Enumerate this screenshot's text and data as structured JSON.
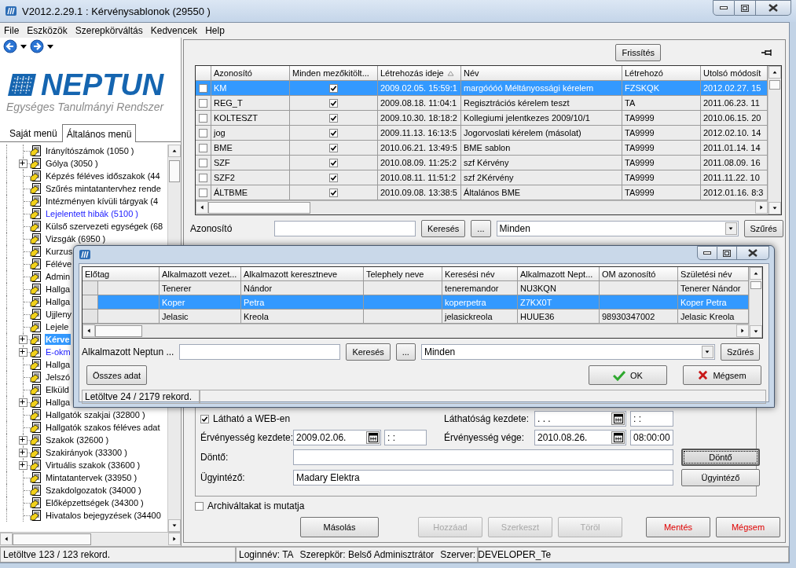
{
  "window": {
    "title": "V2012.2.29.1 : Kérvénysablonok (29550  )"
  },
  "menu": [
    "File",
    "Eszközök",
    "Szerepkörváltás",
    "Kedvencek",
    "Help"
  ],
  "sidebar": {
    "logo": {
      "name": "NEPTUN",
      "tagline": "Egységes Tanulmányi Rendszer"
    },
    "tabs": [
      {
        "label": "Saját menü",
        "selected": false
      },
      {
        "label": "Általános menü",
        "selected": true
      }
    ],
    "tree": [
      {
        "label": "Irányítószámok (1050  )",
        "kind": "normal",
        "expandable": false,
        "selected": false
      },
      {
        "label": "Gólya (3050  )",
        "kind": "normal",
        "expandable": true,
        "selected": false
      },
      {
        "label": "Képzés féléves időszakok (44",
        "kind": "normal",
        "expandable": false,
        "selected": false
      },
      {
        "label": "Szűrés mintatantervhez rende",
        "kind": "normal",
        "expandable": false,
        "selected": false
      },
      {
        "label": "Intézményen kívüli tárgyak (4",
        "kind": "normal",
        "expandable": false,
        "selected": false
      },
      {
        "label": "Lejelentett hibák (5100  )",
        "kind": "link",
        "expandable": false,
        "selected": false
      },
      {
        "label": "Külső szervezeti egységek (68",
        "kind": "normal",
        "expandable": false,
        "selected": false
      },
      {
        "label": "Vizsgák (6950  )",
        "kind": "normal",
        "expandable": false,
        "selected": false
      },
      {
        "label": "Kurzus",
        "kind": "normal",
        "expandable": false,
        "selected": false
      },
      {
        "label": "Féléve",
        "kind": "normal",
        "expandable": false,
        "selected": false
      },
      {
        "label": "Admin",
        "kind": "normal",
        "expandable": false,
        "selected": false
      },
      {
        "label": "Hallga",
        "kind": "normal",
        "expandable": false,
        "selected": false
      },
      {
        "label": "Hallga",
        "kind": "normal",
        "expandable": false,
        "selected": false
      },
      {
        "label": "Ujjleny",
        "kind": "normal",
        "expandable": false,
        "selected": false
      },
      {
        "label": "Lejele",
        "kind": "normal",
        "expandable": false,
        "selected": false
      },
      {
        "label": "Kérve",
        "kind": "normal",
        "expandable": true,
        "selected": true
      },
      {
        "label": "E-okm",
        "kind": "link",
        "expandable": true,
        "selected": false
      },
      {
        "label": "Hallga",
        "kind": "normal",
        "expandable": false,
        "selected": false
      },
      {
        "label": "Jelszó",
        "kind": "normal",
        "expandable": false,
        "selected": false
      },
      {
        "label": "Elküld",
        "kind": "normal",
        "expandable": false,
        "selected": false
      },
      {
        "label": "Hallga",
        "kind": "normal",
        "expandable": true,
        "selected": false
      },
      {
        "label": "Hallgatók szakjai (32800  )",
        "kind": "normal",
        "expandable": false,
        "selected": false
      },
      {
        "label": "Hallgatók szakos féléves adat",
        "kind": "normal",
        "expandable": false,
        "selected": false
      },
      {
        "label": "Szakok (32600  )",
        "kind": "normal",
        "expandable": true,
        "selected": false
      },
      {
        "label": "Szakirányok (33300  )",
        "kind": "normal",
        "expandable": true,
        "selected": false
      },
      {
        "label": "Virtuális szakok (33600  )",
        "kind": "normal",
        "expandable": true,
        "selected": false
      },
      {
        "label": "Mintatantervek (33950  )",
        "kind": "normal",
        "expandable": false,
        "selected": false
      },
      {
        "label": "Szakdolgozatok (34000  )",
        "kind": "normal",
        "expandable": false,
        "selected": false
      },
      {
        "label": "Előképzettségek (34300  )",
        "kind": "normal",
        "expandable": false,
        "selected": false
      },
      {
        "label": "Hivatalos bejegyzések (34400",
        "kind": "normal",
        "expandable": false,
        "selected": false
      }
    ]
  },
  "templates": {
    "refresh_button": "Frissítés",
    "columns": [
      {
        "label": "Azonosító",
        "sorted": false
      },
      {
        "label": "Minden mezőkitölt...",
        "sorted": false
      },
      {
        "label": "Létrehozás ideje",
        "sorted": true
      },
      {
        "label": "Név",
        "sorted": false
      },
      {
        "label": "Létrehozó",
        "sorted": false
      },
      {
        "label": "Utolsó módosít",
        "sorted": false
      }
    ],
    "rows": [
      {
        "marked": false,
        "selected": true,
        "cells": [
          "KM",
          {
            "kind": "checkbox",
            "checked": true
          },
          "2009.02.05. 15:59:1",
          "margóóóó Méltányossági kérelem",
          "FZSKQK",
          "2012.02.27. 15"
        ]
      },
      {
        "marked": false,
        "selected": false,
        "cells": [
          "REG_T",
          {
            "kind": "checkbox",
            "checked": true
          },
          "2009.08.18. 11:04:1",
          "Regisztrációs kérelem teszt",
          "TA",
          "2011.06.23. 11"
        ]
      },
      {
        "marked": false,
        "selected": false,
        "cells": [
          "KOLTESZT",
          {
            "kind": "checkbox",
            "checked": true
          },
          "2009.10.30. 18:18:2",
          "Kollegiumi jelentkezes 2009/10/1",
          "TA9999",
          "2010.06.15. 20"
        ]
      },
      {
        "marked": false,
        "selected": false,
        "cells": [
          "jog",
          {
            "kind": "checkbox",
            "checked": true
          },
          "2009.11.13. 16:13:5",
          "Jogorvoslati kérelem (másolat)",
          "TA9999",
          "2012.02.10. 14"
        ]
      },
      {
        "marked": false,
        "selected": false,
        "cells": [
          "BME",
          {
            "kind": "checkbox",
            "checked": true
          },
          "2010.06.21. 13:49:5",
          "BME sablon",
          "TA9999",
          "2011.01.14. 14"
        ]
      },
      {
        "marked": false,
        "selected": false,
        "cells": [
          "SZF",
          {
            "kind": "checkbox",
            "checked": true
          },
          "2010.08.09. 11:25:2",
          "szf Kérvény",
          "TA9999",
          "2011.08.09. 16"
        ]
      },
      {
        "marked": false,
        "selected": false,
        "cells": [
          "SZF2",
          {
            "kind": "checkbox",
            "checked": true
          },
          "2010.08.11. 11:51:2",
          "szf 2Kérvény",
          "TA9999",
          "2011.11.22. 10"
        ]
      },
      {
        "marked": false,
        "selected": false,
        "cells": [
          "ÁLTBME",
          {
            "kind": "checkbox",
            "checked": true
          },
          "2010.09.08. 13:38:5",
          "Általános BME",
          "TA9999",
          "2012.01.16. 8:3"
        ]
      }
    ],
    "filter": {
      "label": "Azonosító",
      "search": "Keresés",
      "more": "...",
      "scope": "Minden",
      "filter_button": "Szűrés"
    }
  },
  "dialog": {
    "columns": [
      "Előtag",
      "Alkalmazott vezet...",
      "Alkalmazott keresztneve",
      "Telephely neve",
      "Keresési név",
      "Alkalmazott Nept...",
      "OM azonosító",
      "Születési név"
    ],
    "rows": [
      {
        "selected": false,
        "cells": [
          null,
          "Tenerer",
          "Nándor",
          null,
          "teneremandor",
          "NU3KQN",
          null,
          "Tenerer Nándor"
        ]
      },
      {
        "selected": true,
        "cells": [
          null,
          "Koper",
          "Petra",
          null,
          "koperpetra",
          "Z7KX0T",
          null,
          "Koper Petra"
        ]
      },
      {
        "selected": false,
        "cells": [
          null,
          "Jelasic",
          "Kreola",
          null,
          "jelasickreola",
          "HUUE36",
          "98930347002",
          "Jelasic Kreola"
        ]
      }
    ],
    "filter": {
      "label": "Alkalmazott Neptun ...",
      "search": "Keresés",
      "more": "...",
      "scope": "Minden",
      "filter_button": "Szűrés"
    },
    "all_button": "Összes adat",
    "ok_button": "OK",
    "cancel_button": "Mégsem",
    "status": "Letöltve 24 / 2179 rekord."
  },
  "form": {
    "web_visible": {
      "label": "Látható a WEB-en",
      "checked": true
    },
    "visibility_start": {
      "label": "Láthatóság kezdete:",
      "date": ". . .",
      "time": ": :"
    },
    "validity_start": {
      "label": "Érvényesség kezdete:",
      "date": "2009.02.06.",
      "time": ": :"
    },
    "validity_end": {
      "label": "Érvényesség vége:",
      "date": "2010.08.26.",
      "time": "08:00:00"
    },
    "decider": {
      "label": "Döntő:",
      "button": "Döntő",
      "focused": true
    },
    "clerk": {
      "label": "Ügyintéző:",
      "value": "Madary Elektra",
      "button": "Ügyintéző",
      "focused": false
    },
    "archived": {
      "label": "Archiváltakat is mutatja",
      "checked": false
    }
  },
  "actions": [
    [
      {
        "label": "Másolás",
        "kind": "normal",
        "disabled": false
      }
    ],
    [
      {
        "label": "Hozzáad",
        "kind": "normal",
        "disabled": true
      },
      {
        "label": "Szerkeszt",
        "kind": "normal",
        "disabled": true
      },
      {
        "label": "Töröl",
        "kind": "normal",
        "disabled": true
      }
    ],
    [
      {
        "label": "Mentés",
        "kind": "danger",
        "disabled": false
      },
      {
        "label": "Mégsem",
        "kind": "danger",
        "disabled": false
      }
    ]
  ],
  "status_bar": {
    "records": "Letöltve 123 / 123 rekord.",
    "login": "Loginnév: TA",
    "role": "Szerepkör: Belső Adminisztrátor",
    "server": "Szerver: DEVELOPER_Te"
  }
}
